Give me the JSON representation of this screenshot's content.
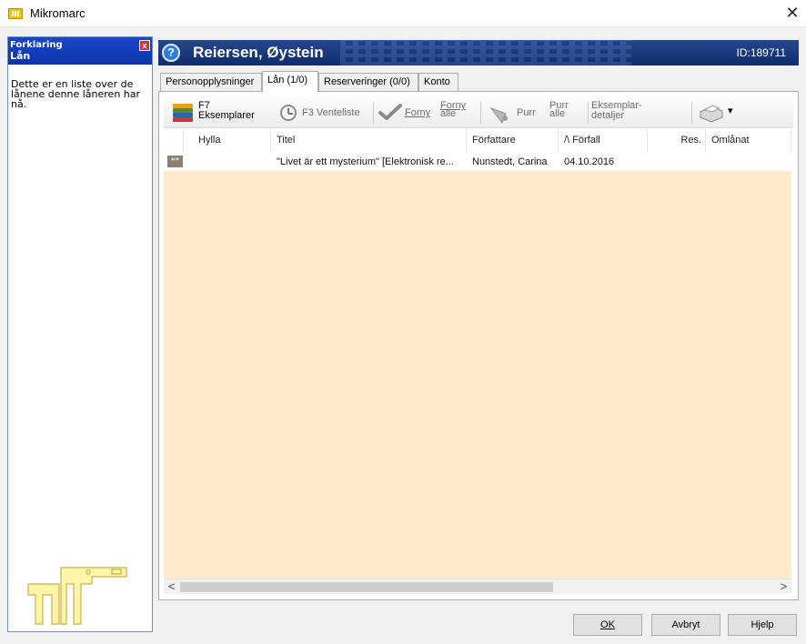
{
  "window": {
    "title": "Mikromarc",
    "close_glyph": "✕",
    "icon": "mikromarc-app-icon"
  },
  "explanation": {
    "header": "Forklaring",
    "subheader": "Lån",
    "close_glyph": "x",
    "text": "Dette er en liste over de lånene denne låneren har nå."
  },
  "patron": {
    "help_glyph": "?",
    "name": "Reiersen, Øystein",
    "id": "ID:189711"
  },
  "tabs": [
    {
      "label": "Personopplysninger",
      "active": false
    },
    {
      "label": "Lån (1/0)",
      "active": true
    },
    {
      "label": "Reserveringer (0/0)",
      "active": false
    },
    {
      "label": "Konto",
      "active": false
    }
  ],
  "toolbar": {
    "f7_line1": "F7",
    "f7_line2": "Eksemplarer",
    "venteliste": "F3 Venteliste",
    "forny": "Forny",
    "forny_alle_line1": "Forny",
    "forny_alle_line2": "alle",
    "purr": "Purr",
    "purr_alle_line1": "Purr",
    "purr_alle_line2": "alle",
    "eksemplar_line1": "Eksemplar-",
    "eksemplar_line2": "detaljer",
    "print_dropdown_glyph": "▾"
  },
  "grid": {
    "columns": [
      "Hylla",
      "Titel",
      "Författare",
      "/\\ Förfall",
      "Res.",
      "Omlånat"
    ],
    "rows": [
      {
        "icon_glyph": "“”",
        "hylla": "",
        "titel": "\"Livet är ett mysterium\" [Elektronisk re...",
        "forfattare": "Nunstedt, Carina",
        "forfall": "04.10.2016",
        "res": "",
        "omlanat": ""
      }
    ]
  },
  "scrollbar": {
    "left_glyph": "<",
    "right_glyph": ">"
  },
  "buttons": {
    "ok": "OK",
    "avbryt": "Avbryt",
    "hjelp": "Hjelp"
  },
  "colors": {
    "header_blue": "#102d6d",
    "grid_background": "#ffeacb",
    "explanation_header": "#0c35a9"
  }
}
